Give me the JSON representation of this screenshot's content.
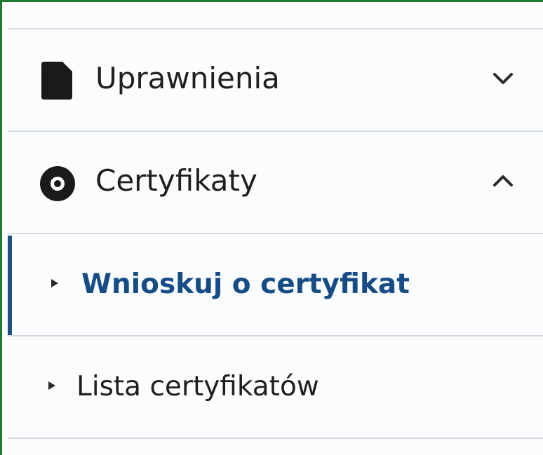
{
  "menu": {
    "items": [
      {
        "label": "Uprawnienia",
        "icon": "document-icon",
        "expanded": false,
        "chevron": "chevron-down-icon"
      },
      {
        "label": "Certyfikaty",
        "icon": "disc-icon",
        "expanded": true,
        "chevron": "chevron-up-icon",
        "children": [
          {
            "label": "Wnioskuj o certyfikat",
            "active": true,
            "bullet": "triangle-bullet-icon"
          },
          {
            "label": "Lista certyfikatów",
            "active": false,
            "bullet": "triangle-bullet-icon"
          }
        ]
      }
    ]
  },
  "colors": {
    "frame_border": "#1f7a2f",
    "active_text": "#164c86",
    "active_indicator": "#1d4f7f",
    "separator": "#d7dbe0",
    "text": "#1f1f1f"
  }
}
